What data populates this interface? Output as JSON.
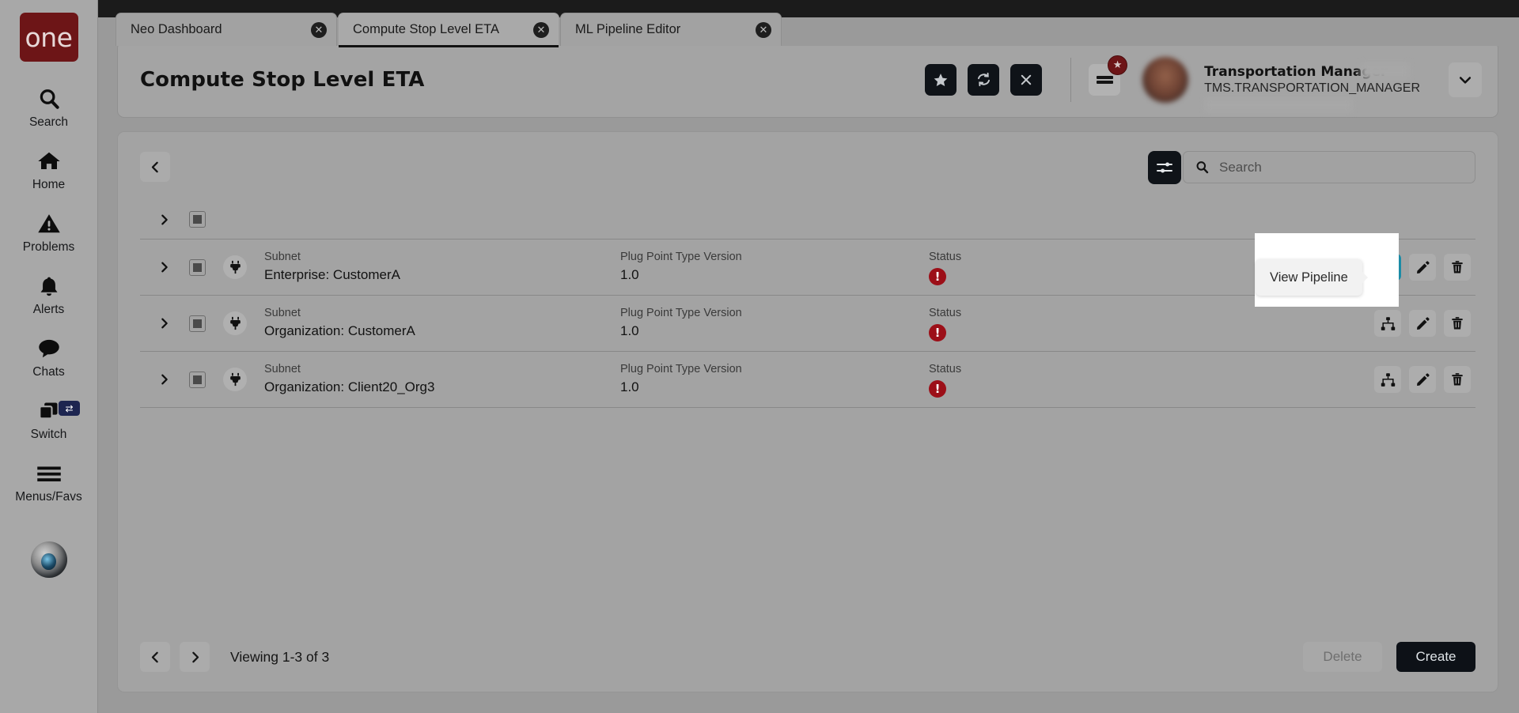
{
  "brand": {
    "logo_text": "one",
    "logo_color": "#6d1517"
  },
  "colors": {
    "accent_teal": "#1b8ba6",
    "status_error": "#9c0f18",
    "dark_button": "#0f1318",
    "page_bg": "#9a9a9a"
  },
  "rail": {
    "items": [
      {
        "label": "Search",
        "icon": "search-icon"
      },
      {
        "label": "Home",
        "icon": "home-icon"
      },
      {
        "label": "Problems",
        "icon": "warning-triangle-icon"
      },
      {
        "label": "Alerts",
        "icon": "bell-icon"
      },
      {
        "label": "Chats",
        "icon": "chat-bubble-icon"
      },
      {
        "label": "Switch",
        "icon": "switch-windows-icon",
        "badge_icon": "swap-arrows-icon"
      },
      {
        "label": "Menus/Favs",
        "icon": "hamburger-icon"
      }
    ],
    "avatar_icon": "user-avatar-orb"
  },
  "tabs": [
    {
      "label": "Neo Dashboard",
      "active": false,
      "close_icon": "close-icon"
    },
    {
      "label": "Compute Stop Level ETA",
      "active": true,
      "close_icon": "close-icon"
    },
    {
      "label": "ML Pipeline Editor",
      "active": false,
      "close_icon": "close-icon"
    }
  ],
  "header": {
    "title": "Compute Stop Level ETA",
    "actions": [
      {
        "name": "favorite-button",
        "icon": "star-icon"
      },
      {
        "name": "refresh-button",
        "icon": "refresh-icon"
      },
      {
        "name": "close-page-button",
        "icon": "close-x-icon"
      }
    ],
    "menu_button": {
      "icon": "hamburger-icon",
      "badge_icon": "star-icon"
    },
    "user": {
      "name": "Transportation Manager",
      "role": "TMS.TRANSPORTATION_MANAGER",
      "caret_icon": "chevron-down-icon"
    }
  },
  "toolbar": {
    "back_icon": "chevron-left-icon",
    "filter_icon": "filter-sliders-icon",
    "search": {
      "placeholder": "Search",
      "value": "",
      "icon": "search-icon"
    }
  },
  "table": {
    "header_row": {
      "expander_icon": "chevron-right-icon",
      "checkbox_state": "indeterminate"
    },
    "rows": [
      {
        "expander_icon": "chevron-right-icon",
        "checkbox_state": "indeterminate",
        "type_icon": "plug-icon",
        "name_label": "Subnet",
        "name_value": "Enterprise: CustomerA",
        "version_label": "Plug Point Type Version",
        "version_value": "1.0",
        "status_label": "Status",
        "status_icon": "error-exclamation-icon",
        "actions": [
          {
            "name": "view-pipeline-button",
            "icon": "pipeline-graph-icon",
            "active": true
          },
          {
            "name": "edit-button",
            "icon": "pencil-icon",
            "active": false
          },
          {
            "name": "delete-button",
            "icon": "trash-icon",
            "active": false
          }
        ]
      },
      {
        "expander_icon": "chevron-right-icon",
        "checkbox_state": "indeterminate",
        "type_icon": "plug-icon",
        "name_label": "Subnet",
        "name_value": "Organization: CustomerA",
        "version_label": "Plug Point Type Version",
        "version_value": "1.0",
        "status_label": "Status",
        "status_icon": "error-exclamation-icon",
        "actions": [
          {
            "name": "view-pipeline-button",
            "icon": "pipeline-graph-icon",
            "active": false
          },
          {
            "name": "edit-button",
            "icon": "pencil-icon",
            "active": false
          },
          {
            "name": "delete-button",
            "icon": "trash-icon",
            "active": false
          }
        ]
      },
      {
        "expander_icon": "chevron-right-icon",
        "checkbox_state": "indeterminate",
        "type_icon": "plug-icon",
        "name_label": "Subnet",
        "name_value": "Organization: Client20_Org3",
        "version_label": "Plug Point Type Version",
        "version_value": "1.0",
        "status_label": "Status",
        "status_icon": "error-exclamation-icon",
        "actions": [
          {
            "name": "view-pipeline-button",
            "icon": "pipeline-graph-icon",
            "active": false
          },
          {
            "name": "edit-button",
            "icon": "pencil-icon",
            "active": false
          },
          {
            "name": "delete-button",
            "icon": "trash-icon",
            "active": false
          }
        ]
      }
    ]
  },
  "tooltip": {
    "text": "View Pipeline"
  },
  "footer": {
    "prev_icon": "chevron-left-icon",
    "next_icon": "chevron-right-icon",
    "viewing_text": "Viewing 1-3 of 3",
    "delete_label": "Delete",
    "create_label": "Create"
  }
}
